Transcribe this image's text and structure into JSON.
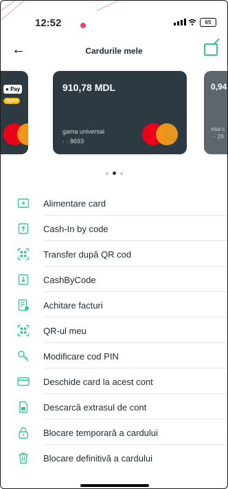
{
  "status_bar": {
    "time": "12:52",
    "battery": "65"
  },
  "header": {
    "title": "Cardurile mele"
  },
  "cards": {
    "left": {
      "pay_label": "Pay",
      "digital_label": "digital"
    },
    "center": {
      "amount": "910,78 MDL",
      "name": "gama universal",
      "digits": "· · 8693"
    },
    "right": {
      "amount": "0,94",
      "name": "visa c",
      "digits": "· · 29"
    }
  },
  "menu": [
    {
      "label": "Alimentare card",
      "icon": "topup-card-icon"
    },
    {
      "label": "Cash-In by code",
      "icon": "cash-in-icon"
    },
    {
      "label": "Transfer după QR cod",
      "icon": "qr-transfer-icon"
    },
    {
      "label": "CashByCode",
      "icon": "cash-by-code-icon"
    },
    {
      "label": "Achitare facturi",
      "icon": "invoice-icon"
    },
    {
      "label": "QR-ul meu",
      "icon": "qr-icon"
    },
    {
      "label": "Modificare cod PIN",
      "icon": "key-icon"
    },
    {
      "label": "Deschide card la acest cont",
      "icon": "open-card-icon"
    },
    {
      "label": "Descarcă extrasul de cont",
      "icon": "download-statement-icon"
    },
    {
      "label": "Blocare temporară a cardului",
      "icon": "lock-icon"
    },
    {
      "label": "Blocare definitivă a cardului",
      "icon": "trash-icon"
    }
  ],
  "colors": {
    "accent": "#38c4a1",
    "card_dark": "#2e3a42",
    "mastercard_red": "#eb001b",
    "mastercard_orange": "#f79e1b"
  }
}
